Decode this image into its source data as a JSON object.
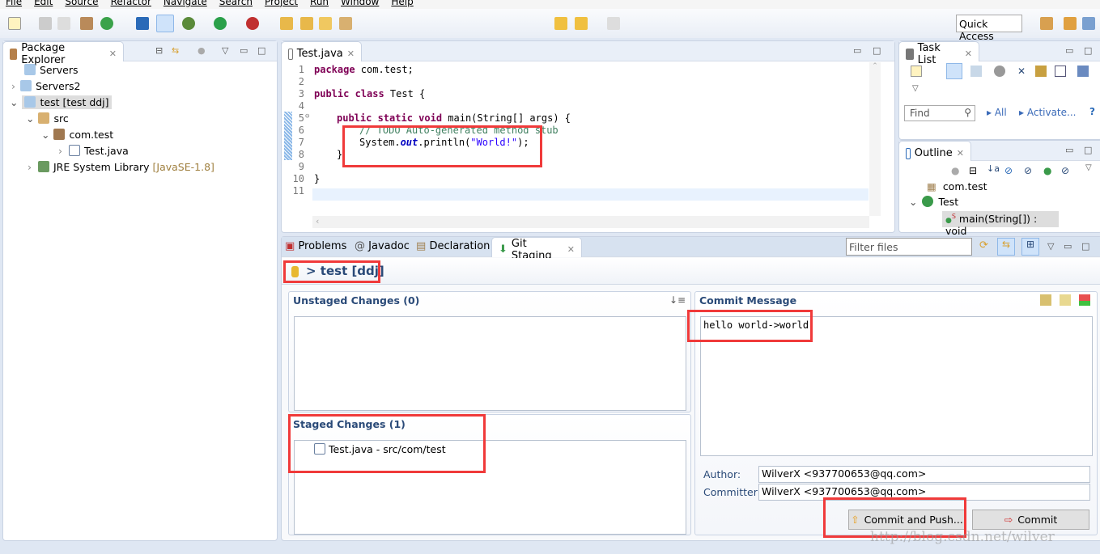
{
  "menu": [
    "File",
    "Edit",
    "Source",
    "Refactor",
    "Navigate",
    "Search",
    "Project",
    "Run",
    "Window",
    "Help"
  ],
  "quick_access": "Quick Access",
  "package_explorer": {
    "title": "Package Explorer",
    "items": [
      {
        "label": "Servers",
        "extra": ""
      },
      {
        "label": "Servers2",
        "extra": ""
      },
      {
        "label": "test [test ddj]",
        "extra": ""
      },
      {
        "label": "src",
        "extra": ""
      },
      {
        "label": "com.test",
        "extra": ""
      },
      {
        "label": "Test.java",
        "extra": ""
      },
      {
        "label": "JRE System Library",
        "extra": "[JavaSE-1.8]"
      }
    ]
  },
  "editor": {
    "tab": "Test.java",
    "lines": [
      "1",
      "2",
      "3",
      "4",
      "5",
      "6",
      "7",
      "8",
      "9",
      "10",
      "11"
    ],
    "code": {
      "l1a": "package",
      "l1b": " com.test;",
      "l3a": "public class",
      "l3b": " Test {",
      "l5a": "public static void",
      "l5b": " main(String[] args) {",
      "l6": "// TODO Auto-generated method stub",
      "l7a": "System.",
      "l7b": "out",
      "l7c": ".println(",
      "l7d": "\"World!\"",
      "l7e": ");",
      "l8": "}",
      "l10": "}"
    }
  },
  "task_list": {
    "title": "Task List",
    "find_placeholder": "Find",
    "all": "All",
    "activate": "Activate..."
  },
  "outline": {
    "title": "Outline",
    "items": [
      "com.test",
      "Test",
      "main(String[]) : void"
    ],
    "static_marker": "S"
  },
  "bottom": {
    "tabs": [
      "Problems",
      "Javadoc",
      "Declaration",
      "Git Staging"
    ],
    "filter_placeholder": "Filter files",
    "repo": "> test [ddj]",
    "unstaged": "Unstaged Changes (0)",
    "staged": "Staged Changes (1)",
    "staged_files": [
      "Test.java - src/com/test"
    ],
    "commit_message_title": "Commit Message",
    "commit_message": "hello world->world",
    "author_label": "Author:",
    "author": "WilverX <937700653@qq.com>",
    "committer_label": "Committer:",
    "committer": "WilverX <937700653@qq.com>",
    "commit_push": "Commit and Push...",
    "commit": "Commit"
  },
  "watermark": "http://blog.csdn.net/wilver",
  "colors": {
    "annotation": "#f03a3a",
    "section_header": "#2a4a78",
    "background": "#dfe7f3"
  }
}
